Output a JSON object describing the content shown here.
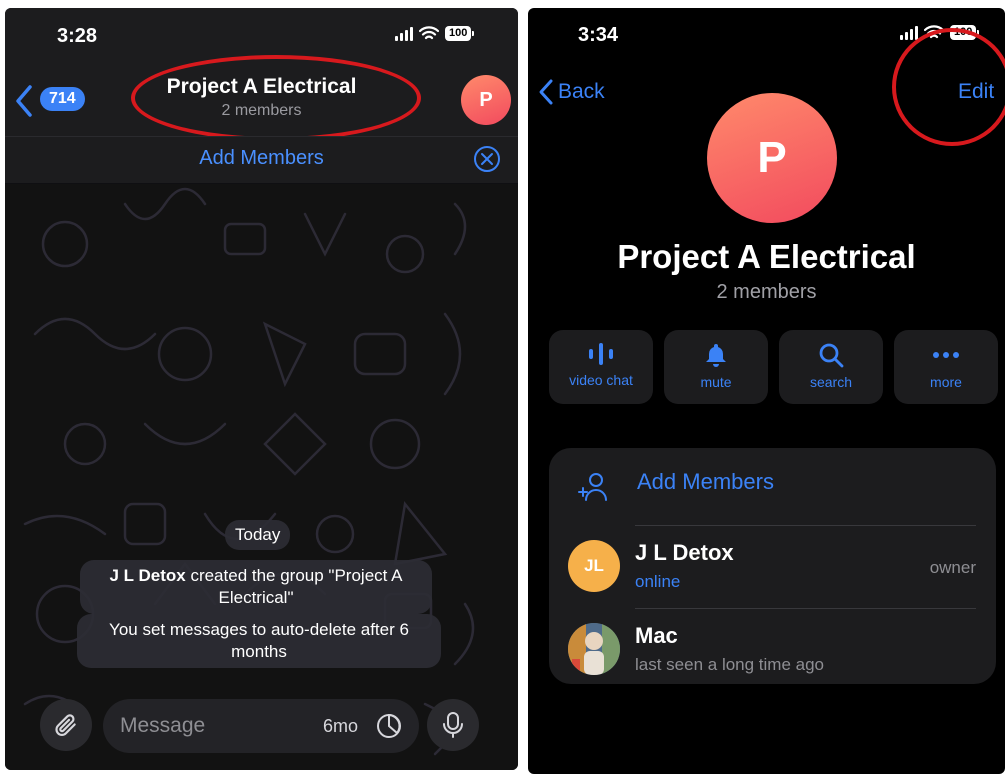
{
  "left": {
    "status_time": "3:28",
    "battery": "100",
    "unread_count": "714",
    "chat_title": "Project A Electrical",
    "chat_subtitle": "2 members",
    "avatar_letter": "P",
    "add_members_label": "Add Members",
    "date_separator": "Today",
    "system_msg_1_name": "J L Detox",
    "system_msg_1_line1": " created the group \"Project A",
    "system_msg_1_line2": "Electrical\"",
    "system_msg_2_line1": "You set messages to auto-delete after 6",
    "system_msg_2_line2": "months",
    "message_placeholder": "Message",
    "auto_delete_label": "6mo"
  },
  "right": {
    "status_time": "3:34",
    "battery": "100",
    "back_label": "Back",
    "edit_label": "Edit",
    "avatar_letter": "P",
    "group_title": "Project A Electrical",
    "group_subtitle": "2 members",
    "actions": [
      {
        "label": "video chat",
        "icon": "voice-chat-icon"
      },
      {
        "label": "mute",
        "icon": "bell-icon"
      },
      {
        "label": "search",
        "icon": "search-icon"
      },
      {
        "label": "more",
        "icon": "more-icon"
      }
    ],
    "add_members_label": "Add Members",
    "members": [
      {
        "initials": "JL",
        "name": "J L Detox",
        "status": "online",
        "role": "owner"
      },
      {
        "initials": "",
        "name": "Mac",
        "status": "last seen a long time ago",
        "role": ""
      }
    ]
  },
  "colors": {
    "accent_blue": "#3b82f6",
    "annotation_red": "#d7191d",
    "avatar_gradient_start": "#ff8a6b",
    "avatar_gradient_end": "#f24a5e",
    "jl_avatar": "#f6b04a"
  }
}
